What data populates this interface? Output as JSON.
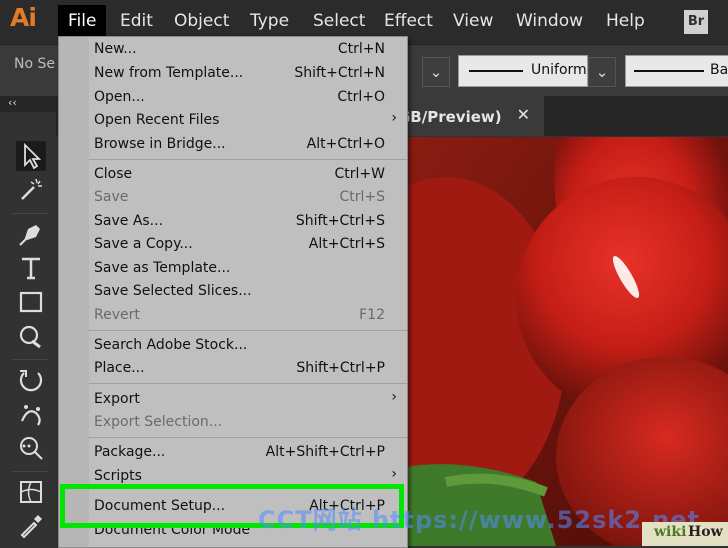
{
  "app": {
    "logo": "Ai",
    "bridge_badge": "Br"
  },
  "menubar": {
    "file": "File",
    "edit": "Edit",
    "object": "Object",
    "type": "Type",
    "select": "Select",
    "effect": "Effect",
    "view": "View",
    "window": "Window",
    "help": "Help"
  },
  "controlbar": {
    "no_selection": "No Se",
    "stroke_profile": "Uniform",
    "brush": "Ba"
  },
  "document_tab": {
    "title": "GB/Preview)",
    "close": "✕"
  },
  "panel": {
    "collapse": "‹‹"
  },
  "file_menu": {
    "new": {
      "label": "New...",
      "shortcut": "Ctrl+N"
    },
    "new_template": {
      "label": "New from Template...",
      "shortcut": "Shift+Ctrl+N"
    },
    "open": {
      "label": "Open...",
      "shortcut": "Ctrl+O"
    },
    "open_recent": {
      "label": "Open Recent Files",
      "submenu": "›"
    },
    "browse_bridge": {
      "label": "Browse in Bridge...",
      "shortcut": "Alt+Ctrl+O"
    },
    "close": {
      "label": "Close",
      "shortcut": "Ctrl+W"
    },
    "save": {
      "label": "Save",
      "shortcut": "Ctrl+S"
    },
    "save_as": {
      "label": "Save As...",
      "shortcut": "Shift+Ctrl+S"
    },
    "save_copy": {
      "label": "Save a Copy...",
      "shortcut": "Alt+Ctrl+S"
    },
    "save_template": {
      "label": "Save as Template..."
    },
    "save_slices": {
      "label": "Save Selected Slices..."
    },
    "revert": {
      "label": "Revert",
      "shortcut": "F12"
    },
    "search_stock": {
      "label": "Search Adobe Stock..."
    },
    "place": {
      "label": "Place...",
      "shortcut": "Shift+Ctrl+P"
    },
    "export": {
      "label": "Export",
      "submenu": "›"
    },
    "export_selection": {
      "label": "Export Selection..."
    },
    "package": {
      "label": "Package...",
      "shortcut": "Alt+Shift+Ctrl+P"
    },
    "scripts": {
      "label": "Scripts",
      "submenu": "›"
    },
    "document_setup": {
      "label": "Document Setup...",
      "shortcut": "Alt+Ctrl+P"
    },
    "document_color_mode": {
      "label": "Document Color Mode"
    }
  },
  "watermark": "CCT网站 https://www.52sk2.net",
  "badge": {
    "wiki": "wiki",
    "how": "How"
  },
  "colors": {
    "highlight": "#00e600",
    "logo": "#e07b2a",
    "menu_bg": "#bfbfbf"
  }
}
